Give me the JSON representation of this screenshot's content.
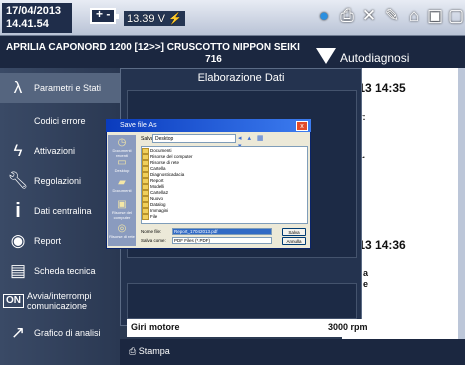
{
  "status": {
    "date": "17/04/2013",
    "time": "14.41.54",
    "battery_sign": "+ -",
    "voltage": "13.39 V",
    "icons": [
      "bluetooth-icon",
      "printer-icon",
      "tools-icon",
      "pen-icon",
      "home-icon",
      "window-icon",
      "display-icon"
    ]
  },
  "header": {
    "model_line1": "APRILIA CAPONORD 1200 [12>>] CRUSCOTTO NIPPON SEIKI",
    "model_line2": "716",
    "autodiag_label": "Autodiagnosi"
  },
  "sidebar": {
    "items": [
      {
        "label": "Parametri e Stati",
        "icon": "lambda-icon",
        "selected": true
      },
      {
        "label": "Codici errore",
        "icon": "",
        "selected": false
      },
      {
        "label": "Attivazioni",
        "icon": "lightning-icon",
        "selected": false
      },
      {
        "label": "Regolazioni",
        "icon": "wrench-icon",
        "selected": false
      },
      {
        "label": "Dati centralina",
        "icon": "info-icon",
        "selected": false
      },
      {
        "label": "Report",
        "icon": "report-icon",
        "selected": false
      },
      {
        "label": "Scheda tecnica",
        "icon": "document-icon",
        "selected": false
      },
      {
        "label_line1": "Avvia/interrompi",
        "label_line2": "comunicazione",
        "icon_text": "ON",
        "selected": false
      },
      {
        "label": "Grafico di analisi",
        "icon": "chart-icon",
        "selected": false
      }
    ]
  },
  "right_panel": {
    "time1": "2013 14:35",
    "frag1": "izer:",
    "frag2": "(c.a.",
    "time2": "2013 14:36",
    "frag3": "a",
    "frag4": "e"
  },
  "dialog": {
    "title": "Elaborazione Dati"
  },
  "file_dialog": {
    "title": "Save file As",
    "close": "x",
    "lookin_label": "Salva in:",
    "lookin_value": "Desktop",
    "sidebar": [
      "Documenti recenti",
      "Desktop",
      "Documenti",
      "Risorse del computer",
      "Risorse di rete"
    ],
    "files": [
      "Documenti",
      "Risorse del computer",
      "Risorse di rete",
      "Cartella",
      "Diagnosticadacia",
      "Report",
      "Modelli",
      "Cartella2",
      "Nuovo",
      "Datalog",
      "Immagini",
      "File"
    ],
    "filename_label": "Nome file:",
    "filename_value": "Report_17042013.pdf",
    "filetype_label": "Salva come:",
    "filetype_value": "PDF Files (*.PDF)",
    "save_button": "Salva",
    "cancel_button": "Annulla"
  },
  "bottom": {
    "giri_label": "Giri motore",
    "giri_value": "3000 rpm",
    "print_label": "Stampa"
  }
}
